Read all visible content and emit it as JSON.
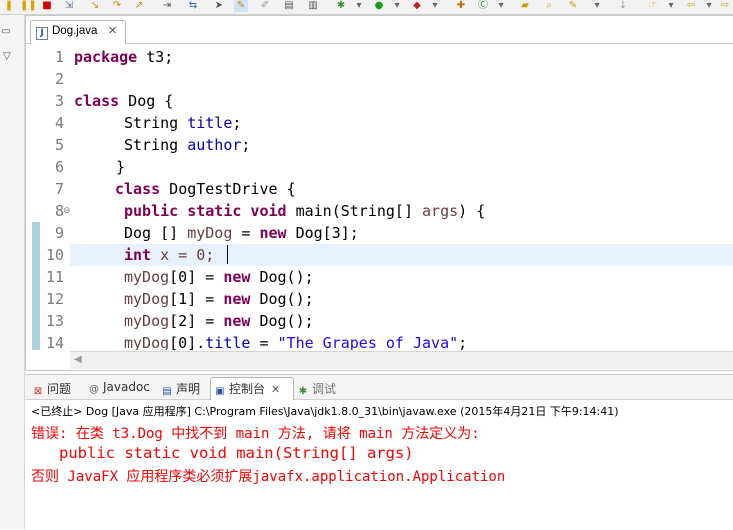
{
  "editor": {
    "tab_label": "Dog.java",
    "lines": [
      {
        "num": "1"
      },
      {
        "num": "2"
      },
      {
        "num": "3"
      },
      {
        "num": "4"
      },
      {
        "num": "5"
      },
      {
        "num": "6"
      },
      {
        "num": "7"
      },
      {
        "num": "8"
      },
      {
        "num": "9"
      },
      {
        "num": "10"
      },
      {
        "num": "11"
      },
      {
        "num": "12"
      },
      {
        "num": "13"
      },
      {
        "num": "14"
      }
    ],
    "code": {
      "l1_kw": "package",
      "l1_rest": " t3;",
      "l3_kw": "class",
      "l3_rest": " Dog {",
      "l4_type": "String ",
      "l4_field": "title",
      "l4_end": ";",
      "l5_type": "String ",
      "l5_field": "author",
      "l5_end": ";",
      "l6": "}",
      "l7_kw": "class",
      "l7_rest": " DogTestDrive {",
      "l8_kw": "public static void",
      "l8_mid": " main(String[] ",
      "l8_arg": "args",
      "l8_end": ") {",
      "l9_a": "Dog [] ",
      "l9_var": "myDog",
      "l9_b": " = ",
      "l9_kw": "new",
      "l9_c": " Dog[3];",
      "l10_kw": "int",
      "l10_rest": " x = 0;",
      "l11_var": "myDog",
      "l11_a": "[0] = ",
      "l11_kw": "new",
      "l11_b": " Dog();",
      "l12_var": "myDog",
      "l12_a": "[1] = ",
      "l12_kw": "new",
      "l12_b": " Dog();",
      "l13_var": "myDog",
      "l13_a": "[2] = ",
      "l13_kw": "new",
      "l13_b": " Dog();",
      "l14_var": "myDog",
      "l14_a": "[0].",
      "l14_field": "title",
      "l14_b": " = ",
      "l14_str": "\"The Grapes of Java\"",
      "l14_end": ";"
    }
  },
  "panel": {
    "tabs": {
      "problems": "问题",
      "javadoc": "Javadoc",
      "declaration": "声明",
      "console": "控制台",
      "debug": "调试"
    },
    "console_status": "<已终止> Dog [Java 应用程序] C:\\Program Files\\Java\\jdk1.8.0_31\\bin\\javaw.exe (2015年4月21日 下午9:14:41)",
    "output": [
      "错误: 在类 t3.Dog 中找不到 main 方法, 请将 main 方法定义为:",
      "   public static void main(String[] args)",
      "否则 JavaFX 应用程序类必须扩展javafx.application.Application"
    ]
  },
  "colors": {
    "keyword": "#7f0055",
    "field": "#0000c0",
    "string": "#2a00ff",
    "error": "#ff0000",
    "current_line": "#e8f2fe"
  }
}
